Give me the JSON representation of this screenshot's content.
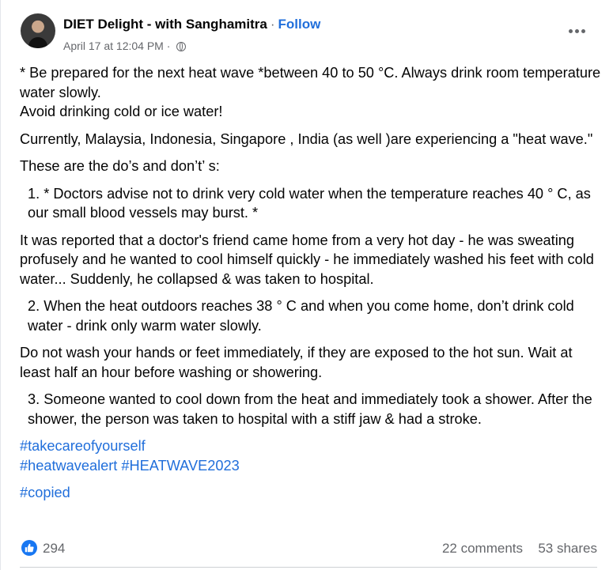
{
  "post": {
    "author": "DIET Delight - with Sanghamitra",
    "separator": "·",
    "follow_label": "Follow",
    "timestamp": "April 17 at 12:04 PM",
    "meta_separator": "·",
    "privacy_icon": "globe-icon",
    "more_icon": "more-options-icon"
  },
  "content": {
    "p1_line1": "* Be prepared for the next heat wave *between 40 to 50 °C. Always drink room temperature water slowly.",
    "p1_line2": "Avoid drinking cold or ice water!",
    "p2": "Currently, Malaysia, Indonesia, Singapore , India (as well )are experiencing a \"heat wave.\"",
    "p3": "These are the do’s and don’t’ s:",
    "p4": "1. * Doctors advise not to drink very cold water when the temperature reaches 40 ° C, as our small blood vessels may burst. *",
    "p5": "It was reported that a doctor's friend came home from a very hot day - he was sweating profusely and he wanted to cool himself quickly - he immediately washed his feet with cold water... Suddenly, he collapsed & was taken to hospital.",
    "p6": "2. When the heat outdoors reaches 38 ° C and when you come home,  don’t drink cold water - drink only warm water slowly.",
    "p7": "Do not wash your hands or feet immediately, if they are exposed to the hot sun. Wait at least half an hour before washing or showering.",
    "p8": "3. Someone wanted to cool down from the heat and immediately took a shower. After the shower, the person was taken to hospital with a stiff jaw & had a stroke.",
    "hashtags": [
      "#takecareofyourself",
      "#heatwavealert",
      "#HEATWAVE2023",
      "#copied"
    ]
  },
  "stats": {
    "reaction_icon": "like-icon",
    "reactions": "294",
    "comments": "22 comments",
    "shares": "53 shares"
  },
  "colors": {
    "link": "#216fdb",
    "secondary_text": "#65676b",
    "like_blue": "#1877f2"
  }
}
